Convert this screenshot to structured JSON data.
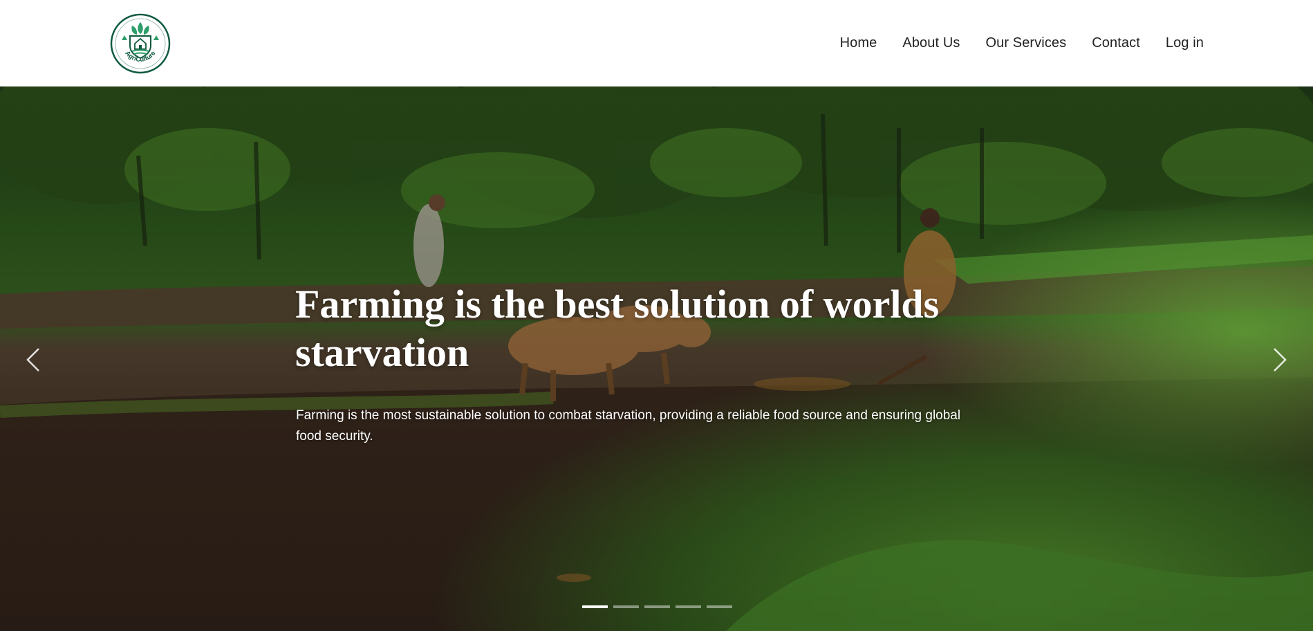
{
  "header": {
    "logo_text": "AgriCulture",
    "nav": [
      {
        "label": "Home"
      },
      {
        "label": "About Us"
      },
      {
        "label": "Our Services"
      },
      {
        "label": "Contact"
      },
      {
        "label": "Log in"
      }
    ]
  },
  "hero": {
    "title": "Farming is the best solution of worlds starvation",
    "text": "Farming is the most sustainable solution to combat starvation, providing a reliable food source and ensuring global food security.",
    "slide_count": 5,
    "active_slide": 1,
    "prev_icon": "chevron-left-icon",
    "next_icon": "chevron-right-icon"
  },
  "colors": {
    "brand": "#0f5a3e",
    "nav_text": "#222222",
    "hero_text": "#ffffff"
  }
}
